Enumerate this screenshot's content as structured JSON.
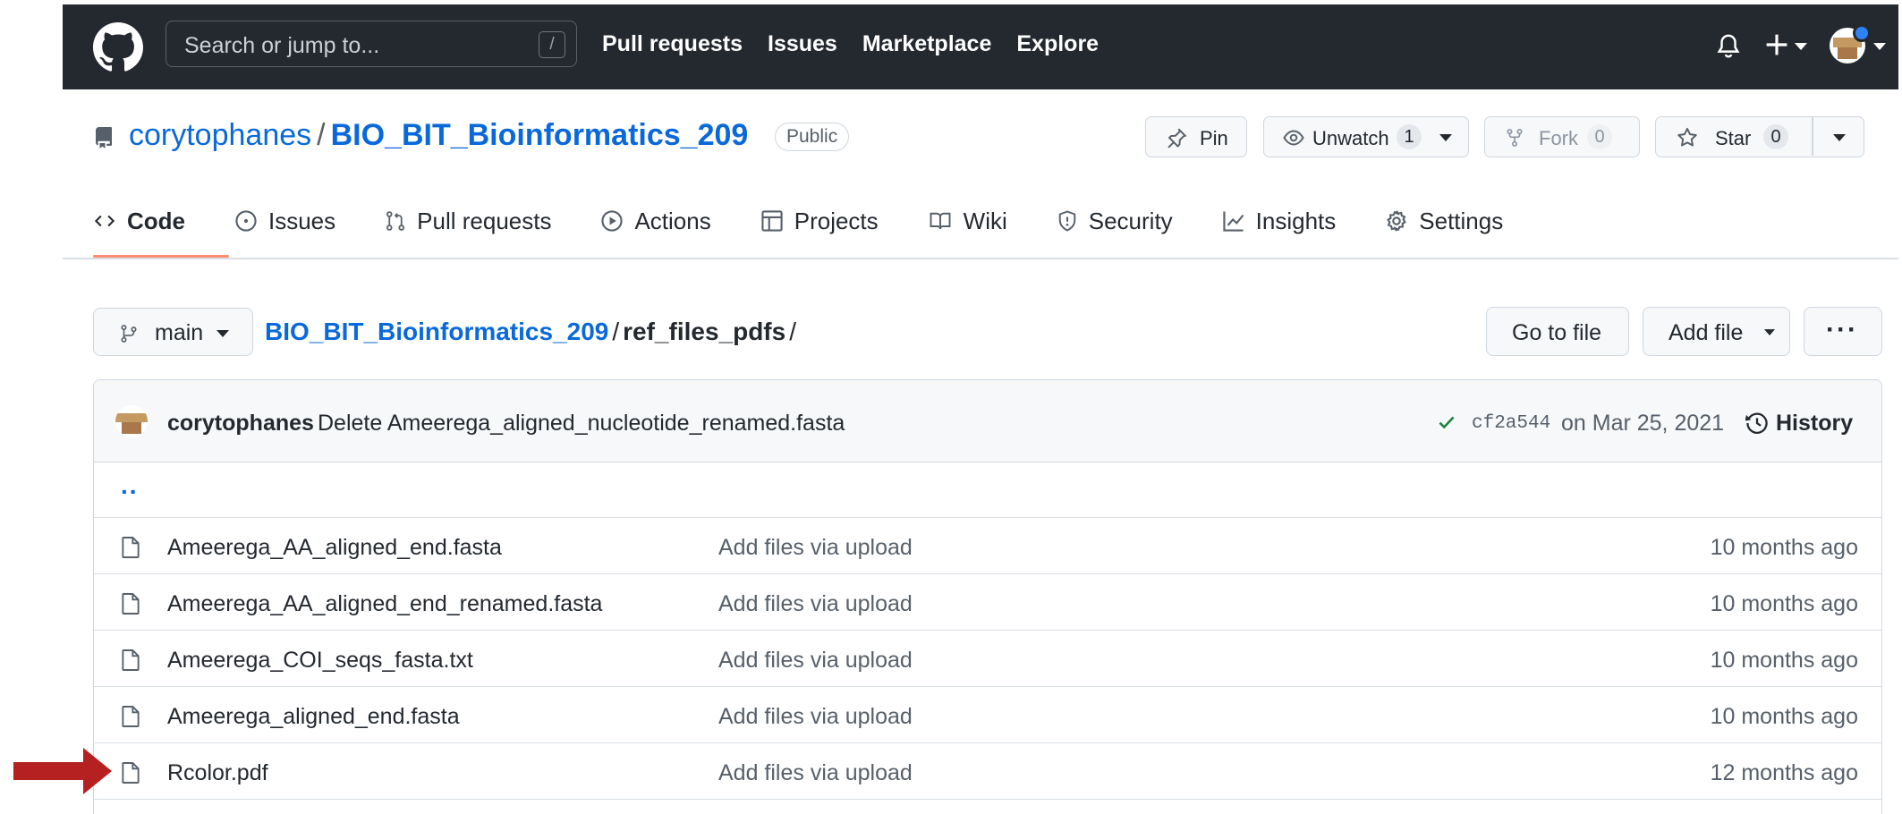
{
  "header": {
    "search_placeholder": "Search or jump to...",
    "search_shortcut": "/",
    "nav": [
      "Pull requests",
      "Issues",
      "Marketplace",
      "Explore"
    ]
  },
  "repo": {
    "owner": "corytophanes",
    "separator": "/",
    "name": "BIO_BIT_Bioinformatics_209",
    "visibility": "Public",
    "actions": {
      "pin_label": "Pin",
      "watch_label": "Unwatch",
      "watch_count": "1",
      "fork_label": "Fork",
      "fork_count": "0",
      "star_label": "Star",
      "star_count": "0"
    }
  },
  "tabs": [
    {
      "label": "Code",
      "icon": "code-icon",
      "active": true
    },
    {
      "label": "Issues",
      "icon": "issue-opened-icon"
    },
    {
      "label": "Pull requests",
      "icon": "git-pull-request-icon"
    },
    {
      "label": "Actions",
      "icon": "play-icon"
    },
    {
      "label": "Projects",
      "icon": "table-icon"
    },
    {
      "label": "Wiki",
      "icon": "book-icon"
    },
    {
      "label": "Security",
      "icon": "shield-icon"
    },
    {
      "label": "Insights",
      "icon": "graph-icon"
    },
    {
      "label": "Settings",
      "icon": "gear-icon"
    }
  ],
  "breadcrumb": {
    "branch": "main",
    "root": "BIO_BIT_Bioinformatics_209",
    "separator": "/",
    "current": "ref_files_pdfs",
    "trailing": "/",
    "go_to_file": "Go to file",
    "add_file": "Add file",
    "more": "···"
  },
  "commit": {
    "author": "corytophanes",
    "message": "Delete Ameerega_aligned_nucleotide_renamed.fasta",
    "sha": "cf2a544",
    "date": "on Mar 25, 2021",
    "history_label": "History"
  },
  "files": {
    "parent_link": "..",
    "rows": [
      {
        "name": "Ameerega_AA_aligned_end.fasta",
        "message": "Add files via upload",
        "age": "10 months ago"
      },
      {
        "name": "Ameerega_AA_aligned_end_renamed.fasta",
        "message": "Add files via upload",
        "age": "10 months ago"
      },
      {
        "name": "Ameerega_COI_seqs_fasta.txt",
        "message": "Add files via upload",
        "age": "10 months ago"
      },
      {
        "name": "Ameerega_aligned_end.fasta",
        "message": "Add files via upload",
        "age": "10 months ago"
      },
      {
        "name": "Rcolor.pdf",
        "message": "Add files via upload",
        "age": "12 months ago"
      }
    ]
  },
  "colors": {
    "header_bg": "#24292f",
    "link": "#0969da",
    "tab_underline": "#fd8c73",
    "annotation_arrow": "#b52020",
    "success": "#1a7f37"
  }
}
